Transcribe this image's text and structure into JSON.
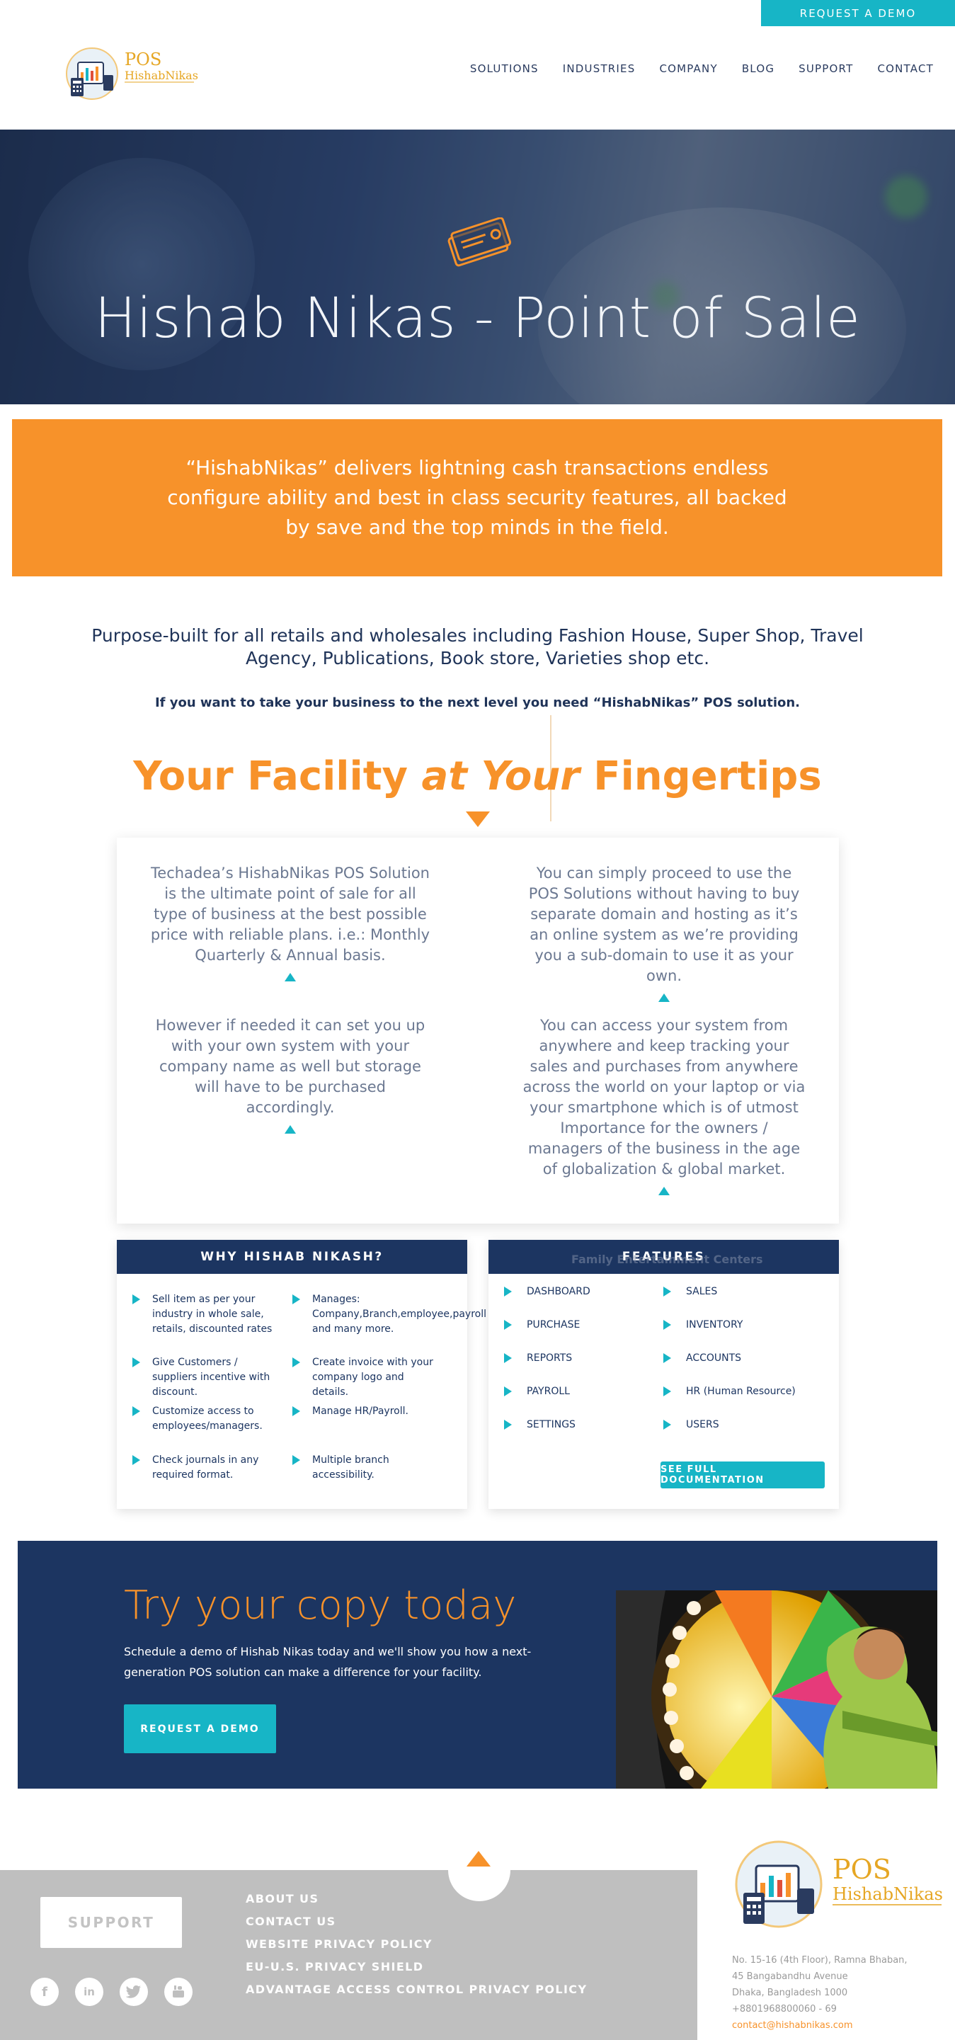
{
  "header": {
    "request_demo": "REQUEST A DEMO",
    "logo_word1": "POS",
    "logo_word2": "HishabNikas",
    "nav": [
      "SOLUTIONS",
      "INDUSTRIES",
      "COMPANY",
      "BLOG",
      "SUPPORT",
      "CONTACT"
    ]
  },
  "hero": {
    "title": "Hishab Nikas - Point of Sale",
    "icon": "ticket-icon"
  },
  "banner": {
    "text": "“HishabNikas” delivers lightning cash transactions endless configure ability and best in class security features, all backed by save and the top minds in the field."
  },
  "intro": {
    "purpose": "Purpose-built for all retails and wholesales including Fashion House, Super Shop, Travel Agency, Publications, Book store, Varieties shop etc.",
    "next_level": "If you want to take your business to the next level you need “HishabNikas” POS solution."
  },
  "facility": {
    "part1": "Your Facility ",
    "part2": "at Your",
    "part3": " Fingertips"
  },
  "info": {
    "block1": "Techadea’s HishabNikas POS Solution is the ultimate point of sale for all type of business at the best possible price with reliable plans. i.e.: Monthly Quarterly & Annual basis.",
    "block2": "You can simply proceed to use the POS Solutions without having to buy separate domain and hosting as it’s an online system as we’re providing you a sub-domain to use it as your own.",
    "block3": "However if needed it can set you up with your own system with your company name as well but storage will have to be purchased accordingly.",
    "block4": "You can access your system from anywhere and keep tracking your sales and purchases from anywhere across the world on your laptop or via your smartphone which is of utmost Importance for the owners / managers of the business in the age of globalization & global market."
  },
  "why": {
    "title": "WHY HISHAB NIKASH?",
    "items": [
      "Sell item as per your industry in whole sale, retails, discounted rates",
      "Manages: Company,Branch,employee,payroll and many more.",
      "Give Customers / suppliers incentive with discount.",
      "Create invoice with your company logo and details.",
      "Customize access to employees/managers.",
      "Manage HR/Payroll.",
      "Check journals in any required format.",
      "Multiple branch accessibility."
    ]
  },
  "features": {
    "title": "FEATURES",
    "ghost": "Family Entertainment Centers",
    "items": [
      "DASHBOARD",
      "SALES",
      "PURCHASE",
      "INVENTORY",
      "REPORTS",
      "ACCOUNTS",
      "PAYROLL",
      "HR (Human Resource)",
      "SETTINGS",
      "USERS"
    ],
    "doc_button": "SEE FULL DOCUMENTATION"
  },
  "try": {
    "title": "Try your copy today",
    "text": "Schedule a demo of Hishab Nikas today and we'll show you how a next-generation POS solution can make a difference for your facility.",
    "button": "REQUEST A DEMO"
  },
  "footer": {
    "support": "SUPPORT",
    "social": [
      "facebook-icon",
      "linkedin-icon",
      "twitter-icon",
      "youtube-icon"
    ],
    "links": [
      "ABOUT US",
      "CONTACT US",
      "WEBSITE PRIVACY POLICY",
      "EU-U.S. PRIVACY SHIELD",
      "ADVANTAGE ACCESS CONTROL PRIVACY POLICY"
    ],
    "address": [
      "No. 15-16 (4th Floor), Ramna Bhaban,",
      "45 Bangabandhu Avenue",
      "Dhaka, Bangladesh 1000",
      "+8801968800060 - 69"
    ],
    "email": "contact@hishabnikas.com"
  },
  "colors": {
    "orange": "#f7922a",
    "teal": "#17b5c6",
    "navy": "#1c3561"
  }
}
